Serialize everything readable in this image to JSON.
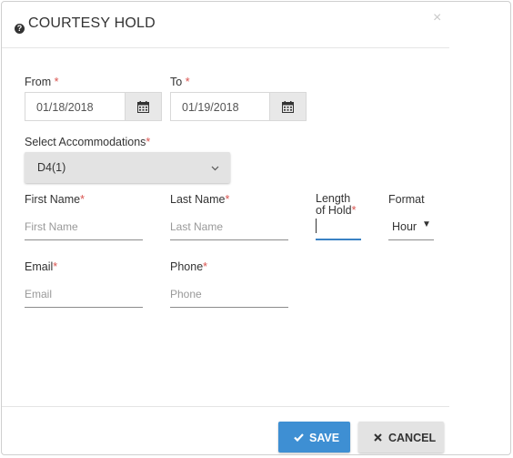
{
  "dialog": {
    "title": "COURTESY HOLD",
    "help_icon": "question-circle-icon",
    "close_icon": "close-icon",
    "close_glyph": "×"
  },
  "dates": {
    "from_label": "From",
    "from_value": "01/18/2018",
    "to_label": "To",
    "to_value": "01/19/2018",
    "calendar_icon": "calendar-icon"
  },
  "accommodations": {
    "label": "Select Accommodations",
    "value": "D4(1)"
  },
  "guest": {
    "first_name_label": "First Name",
    "first_name_placeholder": "First Name",
    "last_name_label": "Last Name",
    "last_name_placeholder": "Last Name",
    "length_label_1": "Length",
    "length_label_2": "of Hold",
    "length_value": "",
    "format_label": "Format",
    "format_value": "Hour",
    "email_label": "Email",
    "email_placeholder": "Email",
    "phone_label": "Phone",
    "phone_placeholder": "Phone"
  },
  "required_mark": "*",
  "buttons": {
    "save_label": "SAVE",
    "save_icon": "check-icon",
    "cancel_label": "CANCEL",
    "cancel_icon": "x-icon"
  },
  "colors": {
    "accent": "#3e8fd3",
    "required": "#d9534f",
    "active_underline": "#3a82c4"
  }
}
